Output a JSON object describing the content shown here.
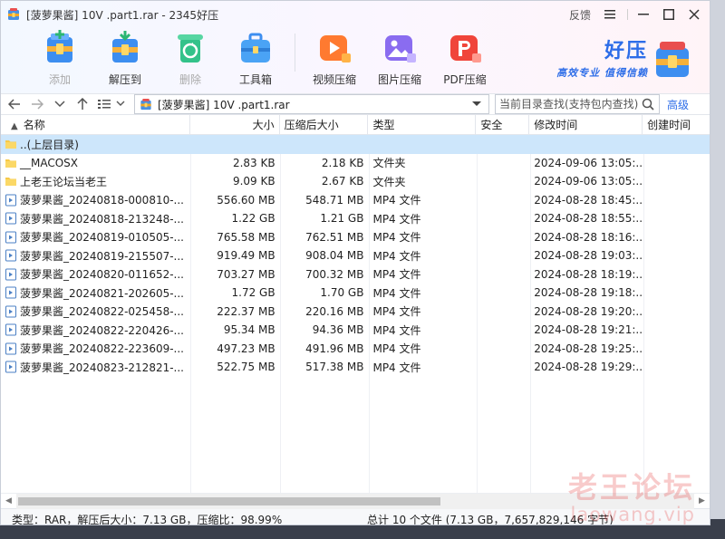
{
  "window": {
    "title": "[菠萝果酱] 10V .part1.rar - 2345好压",
    "feedback": "反馈"
  },
  "toolbar": [
    {
      "label": "添加",
      "icon": "add-archive-icon",
      "enabled": false
    },
    {
      "label": "解压到",
      "icon": "extract-to-icon",
      "enabled": true
    },
    {
      "label": "删除",
      "icon": "recycle-delete-icon",
      "enabled": false
    },
    {
      "label": "工具箱",
      "icon": "toolbox-icon",
      "enabled": true
    },
    {
      "label": "视频压缩",
      "icon": "video-compress-icon",
      "enabled": true
    },
    {
      "label": "图片压缩",
      "icon": "image-compress-icon",
      "enabled": true
    },
    {
      "label": "PDF压缩",
      "icon": "pdf-compress-icon",
      "enabled": true
    }
  ],
  "brand": {
    "name": "好压",
    "slogan": "高效专业 值得信赖"
  },
  "nav": {
    "path": "[菠萝果酱] 10V .part1.rar",
    "search_placeholder": "当前目录查找(支持包内查找)",
    "advanced": "高级"
  },
  "columns": {
    "name": "名称",
    "size": "大小",
    "compressed": "压缩后大小",
    "type": "类型",
    "security": "安全",
    "modified": "修改时间",
    "created": "创建时间"
  },
  "files": [
    {
      "name": "..(上层目录)",
      "size": "",
      "compressed": "",
      "type": "",
      "modified": "",
      "kind": "folder",
      "selected": true
    },
    {
      "name": "__MACOSX",
      "size": "2.83 KB",
      "compressed": "2.18 KB",
      "type": "文件夹",
      "modified": "2024-09-06 13:05:...",
      "kind": "folder",
      "selected": false
    },
    {
      "name": "上老王论坛当老王",
      "size": "9.09 KB",
      "compressed": "2.67 KB",
      "type": "文件夹",
      "modified": "2024-09-06 13:05:...",
      "kind": "folder",
      "selected": false
    },
    {
      "name": "菠萝果酱_20240818-000810-...",
      "size": "556.60 MB",
      "compressed": "548.71 MB",
      "type": "MP4 文件",
      "modified": "2024-08-28 18:45:...",
      "kind": "video",
      "selected": false
    },
    {
      "name": "菠萝果酱_20240818-213248-...",
      "size": "1.22 GB",
      "compressed": "1.21 GB",
      "type": "MP4 文件",
      "modified": "2024-08-28 18:55:...",
      "kind": "video",
      "selected": false
    },
    {
      "name": "菠萝果酱_20240819-010505-...",
      "size": "765.58 MB",
      "compressed": "762.51 MB",
      "type": "MP4 文件",
      "modified": "2024-08-28 18:16:...",
      "kind": "video",
      "selected": false
    },
    {
      "name": "菠萝果酱_20240819-215507-...",
      "size": "919.49 MB",
      "compressed": "908.04 MB",
      "type": "MP4 文件",
      "modified": "2024-08-28 19:03:...",
      "kind": "video",
      "selected": false
    },
    {
      "name": "菠萝果酱_20240820-011652-...",
      "size": "703.27 MB",
      "compressed": "700.32 MB",
      "type": "MP4 文件",
      "modified": "2024-08-28 18:19:...",
      "kind": "video",
      "selected": false
    },
    {
      "name": "菠萝果酱_20240821-202605-...",
      "size": "1.72 GB",
      "compressed": "1.70 GB",
      "type": "MP4 文件",
      "modified": "2024-08-28 19:18:...",
      "kind": "video",
      "selected": false
    },
    {
      "name": "菠萝果酱_20240822-025458-...",
      "size": "222.37 MB",
      "compressed": "220.16 MB",
      "type": "MP4 文件",
      "modified": "2024-08-28 19:20:...",
      "kind": "video",
      "selected": false
    },
    {
      "name": "菠萝果酱_20240822-220426-...",
      "size": "95.34 MB",
      "compressed": "94.36 MB",
      "type": "MP4 文件",
      "modified": "2024-08-28 19:21:...",
      "kind": "video",
      "selected": false
    },
    {
      "name": "菠萝果酱_20240822-223609-...",
      "size": "497.23 MB",
      "compressed": "491.96 MB",
      "type": "MP4 文件",
      "modified": "2024-08-28 19:25:...",
      "kind": "video",
      "selected": false
    },
    {
      "name": "菠萝果酱_20240823-212821-...",
      "size": "522.75 MB",
      "compressed": "517.38 MB",
      "type": "MP4 文件",
      "modified": "2024-08-28 19:29:...",
      "kind": "video",
      "selected": false
    }
  ],
  "status": {
    "left": "类型：RAR，解压后大小：7.13 GB，压缩比：98.99%",
    "right": "总计 10 个文件 (7.13 GB，7,657,829,146 字节)"
  },
  "watermark": {
    "main": "老王论坛",
    "sub": "laowang.vip"
  },
  "colors": {
    "accent": "#2d6de8",
    "selection": "#cde6fb",
    "watermark": "#e64646"
  }
}
